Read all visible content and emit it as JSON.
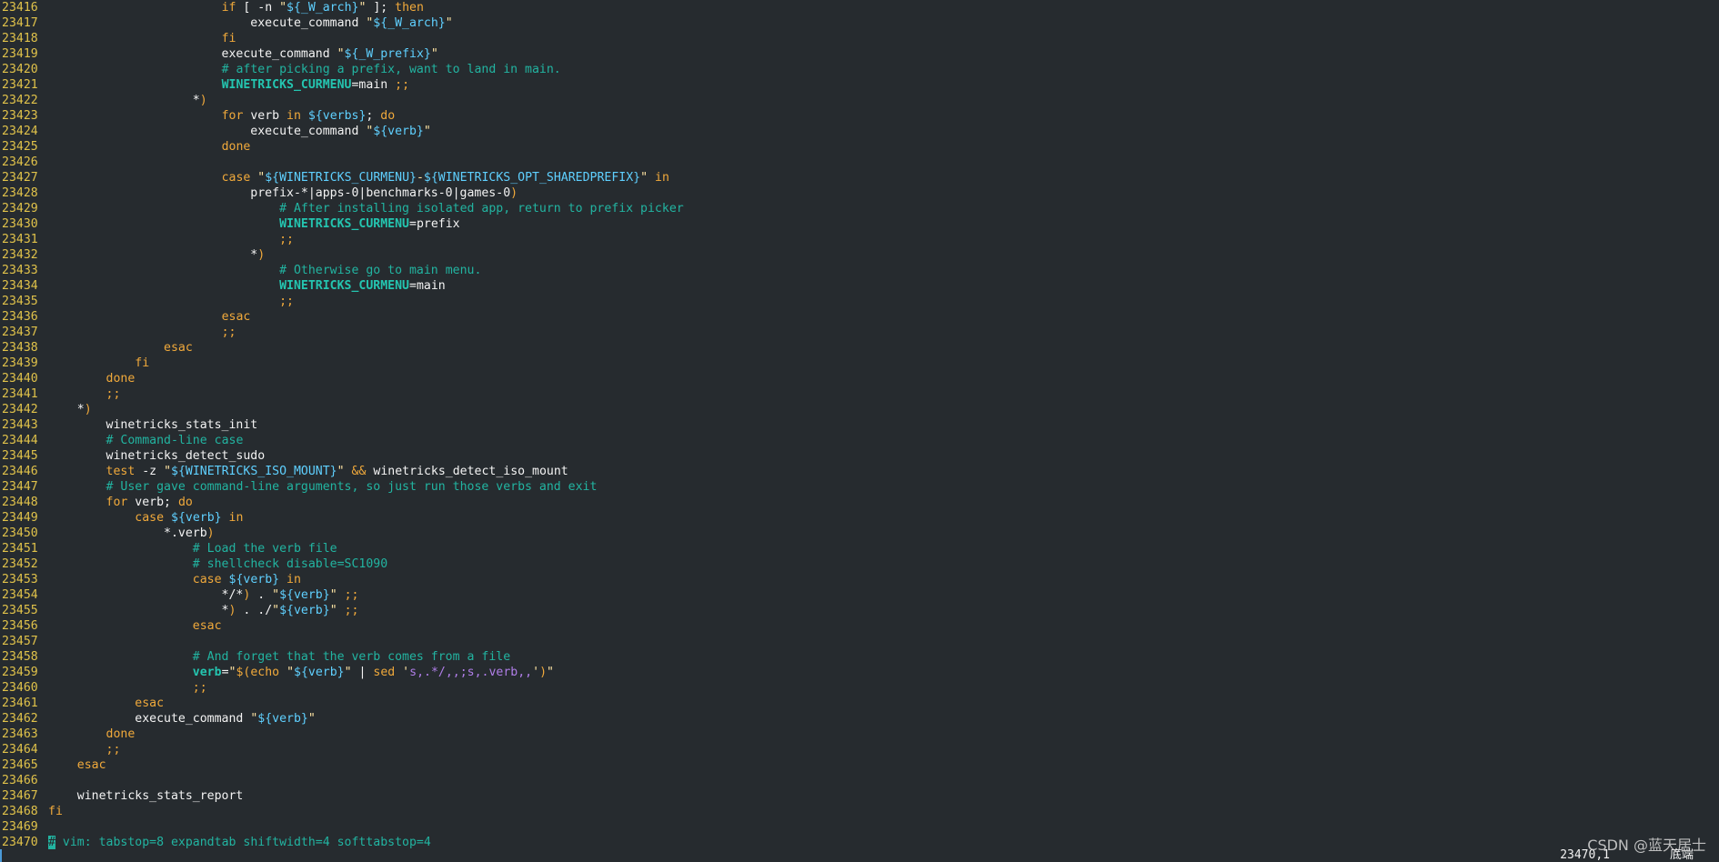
{
  "editor": {
    "lines": [
      {
        "n": "23416",
        "t": [
          [
            "",
            "                        "
          ],
          [
            "kw",
            "if"
          ],
          [
            "",
            " [ -n "
          ],
          [
            "str",
            "\""
          ],
          [
            "var",
            "${_W_arch}"
          ],
          [
            "str",
            "\""
          ],
          [
            "",
            " ]; "
          ],
          [
            "kw",
            "then"
          ]
        ]
      },
      {
        "n": "23417",
        "t": [
          [
            "",
            "                            execute_command "
          ],
          [
            "str",
            "\""
          ],
          [
            "var",
            "${_W_arch}"
          ],
          [
            "str",
            "\""
          ]
        ]
      },
      {
        "n": "23418",
        "t": [
          [
            "",
            "                        "
          ],
          [
            "kw",
            "fi"
          ]
        ]
      },
      {
        "n": "23419",
        "t": [
          [
            "",
            "                        execute_command "
          ],
          [
            "str",
            "\""
          ],
          [
            "var",
            "${_W_prefix}"
          ],
          [
            "str",
            "\""
          ]
        ]
      },
      {
        "n": "23420",
        "t": [
          [
            "",
            "                        "
          ],
          [
            "cmt",
            "# after picking a prefix, want to land in main."
          ]
        ]
      },
      {
        "n": "23421",
        "t": [
          [
            "",
            "                        "
          ],
          [
            "vn",
            "WINETRICKS_CURMENU"
          ],
          [
            "",
            "=main "
          ],
          [
            "op",
            ";;"
          ]
        ]
      },
      {
        "n": "23422",
        "t": [
          [
            "",
            "                    *"
          ],
          [
            "op",
            ")"
          ]
        ]
      },
      {
        "n": "23423",
        "t": [
          [
            "",
            "                        "
          ],
          [
            "kw",
            "for"
          ],
          [
            "",
            " verb "
          ],
          [
            "kw",
            "in"
          ],
          [
            "",
            " "
          ],
          [
            "var",
            "${verbs}"
          ],
          [
            "",
            "; "
          ],
          [
            "kw",
            "do"
          ]
        ]
      },
      {
        "n": "23424",
        "t": [
          [
            "",
            "                            execute_command "
          ],
          [
            "str",
            "\""
          ],
          [
            "var",
            "${verb}"
          ],
          [
            "str",
            "\""
          ]
        ]
      },
      {
        "n": "23425",
        "t": [
          [
            "",
            "                        "
          ],
          [
            "kw",
            "done"
          ]
        ]
      },
      {
        "n": "23426",
        "t": [
          [
            "",
            ""
          ]
        ]
      },
      {
        "n": "23427",
        "t": [
          [
            "",
            "                        "
          ],
          [
            "kw",
            "case"
          ],
          [
            "",
            " "
          ],
          [
            "str",
            "\""
          ],
          [
            "var",
            "${WINETRICKS_CURMENU}"
          ],
          [
            "str",
            "-"
          ],
          [
            "var",
            "${WINETRICKS_OPT_SHAREDPREFIX}"
          ],
          [
            "str",
            "\""
          ],
          [
            "",
            " "
          ],
          [
            "kw",
            "in"
          ]
        ]
      },
      {
        "n": "23428",
        "t": [
          [
            "",
            "                            prefix-*|apps-0|benchmarks-0|games-0"
          ],
          [
            "op",
            ")"
          ]
        ]
      },
      {
        "n": "23429",
        "t": [
          [
            "",
            "                                "
          ],
          [
            "cmt",
            "# After installing isolated app, return to prefix picker"
          ]
        ]
      },
      {
        "n": "23430",
        "t": [
          [
            "",
            "                                "
          ],
          [
            "vn",
            "WINETRICKS_CURMENU"
          ],
          [
            "",
            "=prefix"
          ]
        ]
      },
      {
        "n": "23431",
        "t": [
          [
            "",
            "                                "
          ],
          [
            "op",
            ";;"
          ]
        ]
      },
      {
        "n": "23432",
        "t": [
          [
            "",
            "                            *"
          ],
          [
            "op",
            ")"
          ]
        ]
      },
      {
        "n": "23433",
        "t": [
          [
            "",
            "                                "
          ],
          [
            "cmt",
            "# Otherwise go to main menu."
          ]
        ]
      },
      {
        "n": "23434",
        "t": [
          [
            "",
            "                                "
          ],
          [
            "vn",
            "WINETRICKS_CURMENU"
          ],
          [
            "",
            "=main"
          ]
        ]
      },
      {
        "n": "23435",
        "t": [
          [
            "",
            "                                "
          ],
          [
            "op",
            ";;"
          ]
        ]
      },
      {
        "n": "23436",
        "t": [
          [
            "",
            "                        "
          ],
          [
            "kw",
            "esac"
          ]
        ]
      },
      {
        "n": "23437",
        "t": [
          [
            "",
            "                        "
          ],
          [
            "op",
            ";;"
          ]
        ]
      },
      {
        "n": "23438",
        "t": [
          [
            "",
            "                "
          ],
          [
            "kw",
            "esac"
          ]
        ]
      },
      {
        "n": "23439",
        "t": [
          [
            "",
            "            "
          ],
          [
            "kw",
            "fi"
          ]
        ]
      },
      {
        "n": "23440",
        "t": [
          [
            "",
            "        "
          ],
          [
            "kw",
            "done"
          ]
        ]
      },
      {
        "n": "23441",
        "t": [
          [
            "",
            "        "
          ],
          [
            "op",
            ";;"
          ]
        ]
      },
      {
        "n": "23442",
        "t": [
          [
            "",
            "    *"
          ],
          [
            "op",
            ")"
          ]
        ]
      },
      {
        "n": "23443",
        "t": [
          [
            "",
            "        winetricks_stats_init"
          ]
        ]
      },
      {
        "n": "23444",
        "t": [
          [
            "",
            "        "
          ],
          [
            "cmt",
            "# Command-line case"
          ]
        ]
      },
      {
        "n": "23445",
        "t": [
          [
            "",
            "        winetricks_detect_sudo"
          ]
        ]
      },
      {
        "n": "23446",
        "t": [
          [
            "",
            "        "
          ],
          [
            "kw",
            "test"
          ],
          [
            "",
            " -z "
          ],
          [
            "str",
            "\""
          ],
          [
            "var",
            "${WINETRICKS_ISO_MOUNT}"
          ],
          [
            "str",
            "\""
          ],
          [
            "",
            " "
          ],
          [
            "op",
            "&&"
          ],
          [
            "",
            " winetricks_detect_iso_mount"
          ]
        ]
      },
      {
        "n": "23447",
        "t": [
          [
            "",
            "        "
          ],
          [
            "cmt",
            "# User gave command-line arguments, so just run those verbs and exit"
          ]
        ]
      },
      {
        "n": "23448",
        "t": [
          [
            "",
            "        "
          ],
          [
            "kw",
            "for"
          ],
          [
            "",
            " verb; "
          ],
          [
            "kw",
            "do"
          ]
        ]
      },
      {
        "n": "23449",
        "t": [
          [
            "",
            "            "
          ],
          [
            "kw",
            "case"
          ],
          [
            "",
            " "
          ],
          [
            "var",
            "${verb}"
          ],
          [
            "",
            " "
          ],
          [
            "kw",
            "in"
          ]
        ]
      },
      {
        "n": "23450",
        "t": [
          [
            "",
            "                *.verb"
          ],
          [
            "op",
            ")"
          ]
        ]
      },
      {
        "n": "23451",
        "t": [
          [
            "",
            "                    "
          ],
          [
            "cmt",
            "# Load the verb file"
          ]
        ]
      },
      {
        "n": "23452",
        "t": [
          [
            "",
            "                    "
          ],
          [
            "cmt",
            "# shellcheck disable=SC1090"
          ]
        ]
      },
      {
        "n": "23453",
        "t": [
          [
            "",
            "                    "
          ],
          [
            "kw",
            "case"
          ],
          [
            "",
            " "
          ],
          [
            "var",
            "${verb}"
          ],
          [
            "",
            " "
          ],
          [
            "kw",
            "in"
          ]
        ]
      },
      {
        "n": "23454",
        "t": [
          [
            "",
            "                        */*"
          ],
          [
            "op",
            ")"
          ],
          [
            "",
            " . "
          ],
          [
            "str",
            "\""
          ],
          [
            "var",
            "${verb}"
          ],
          [
            "str",
            "\""
          ],
          [
            "",
            " "
          ],
          [
            "op",
            ";;"
          ]
        ]
      },
      {
        "n": "23455",
        "t": [
          [
            "",
            "                        *"
          ],
          [
            "op",
            ")"
          ],
          [
            "",
            " . ./"
          ],
          [
            "str",
            "\""
          ],
          [
            "var",
            "${verb}"
          ],
          [
            "str",
            "\""
          ],
          [
            "",
            " "
          ],
          [
            "op",
            ";;"
          ]
        ]
      },
      {
        "n": "23456",
        "t": [
          [
            "",
            "                    "
          ],
          [
            "kw",
            "esac"
          ]
        ]
      },
      {
        "n": "23457",
        "t": [
          [
            "",
            ""
          ]
        ]
      },
      {
        "n": "23458",
        "t": [
          [
            "",
            "                    "
          ],
          [
            "cmt",
            "# And forget that the verb comes from a file"
          ]
        ]
      },
      {
        "n": "23459",
        "t": [
          [
            "",
            "                    "
          ],
          [
            "vn",
            "verb"
          ],
          [
            "",
            "="
          ],
          [
            "str",
            "\""
          ],
          [
            "op",
            "$("
          ],
          [
            "kw",
            "echo"
          ],
          [
            "",
            " "
          ],
          [
            "str",
            "\""
          ],
          [
            "var",
            "${verb}"
          ],
          [
            "str",
            "\""
          ],
          [
            "",
            " | "
          ],
          [
            "kw",
            "sed"
          ],
          [
            "",
            " "
          ],
          [
            "str",
            "'"
          ],
          [
            "rx",
            "s,.*/,,;s,.verb,,"
          ],
          [
            "str",
            "'"
          ],
          [
            "op",
            ")"
          ],
          [
            "str",
            "\""
          ]
        ]
      },
      {
        "n": "23460",
        "t": [
          [
            "",
            "                    "
          ],
          [
            "op",
            ";;"
          ]
        ]
      },
      {
        "n": "23461",
        "t": [
          [
            "",
            "            "
          ],
          [
            "kw",
            "esac"
          ]
        ]
      },
      {
        "n": "23462",
        "t": [
          [
            "",
            "            execute_command "
          ],
          [
            "str",
            "\""
          ],
          [
            "var",
            "${verb}"
          ],
          [
            "str",
            "\""
          ]
        ]
      },
      {
        "n": "23463",
        "t": [
          [
            "",
            "        "
          ],
          [
            "kw",
            "done"
          ]
        ]
      },
      {
        "n": "23464",
        "t": [
          [
            "",
            "        "
          ],
          [
            "op",
            ";;"
          ]
        ]
      },
      {
        "n": "23465",
        "t": [
          [
            "",
            "    "
          ],
          [
            "kw",
            "esac"
          ]
        ]
      },
      {
        "n": "23466",
        "t": [
          [
            "",
            ""
          ]
        ]
      },
      {
        "n": "23467",
        "t": [
          [
            "",
            "    winetricks_stats_report"
          ]
        ]
      },
      {
        "n": "23468",
        "t": [
          [
            "kw",
            "fi"
          ]
        ]
      },
      {
        "n": "23469",
        "t": [
          [
            "",
            ""
          ]
        ]
      },
      {
        "n": "23470",
        "t": [
          [
            "cursor",
            "#"
          ],
          [
            "cmt",
            " vim: tabstop=8 expandtab shiftwidth=4 softtabstop=4"
          ]
        ]
      }
    ]
  },
  "status": {
    "position": "23470,1",
    "scroll": "底端"
  },
  "watermark": "CSDN @蓝天居士"
}
